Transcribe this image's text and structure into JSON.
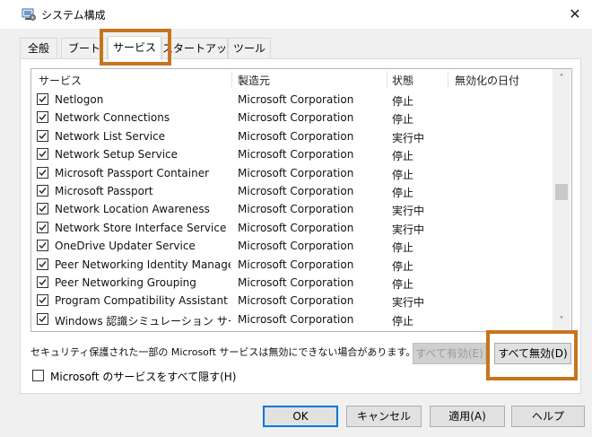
{
  "window": {
    "title": "システム構成",
    "close_glyph": "✕"
  },
  "tabs": [
    {
      "label": "全般"
    },
    {
      "label": "ブート"
    },
    {
      "label": "サービス",
      "active": true
    },
    {
      "label": "スタートアップ"
    },
    {
      "label": "ツール"
    }
  ],
  "services": {
    "columns": [
      "サービス",
      "製造元",
      "状態",
      "無効化の日付"
    ],
    "rows": [
      {
        "name": "Netlogon",
        "maker": "Microsoft Corporation",
        "status": "停止",
        "checked": true
      },
      {
        "name": "Network Connections",
        "maker": "Microsoft Corporation",
        "status": "停止",
        "checked": true
      },
      {
        "name": "Network List Service",
        "maker": "Microsoft Corporation",
        "status": "実行中",
        "checked": true
      },
      {
        "name": "Network Setup Service",
        "maker": "Microsoft Corporation",
        "status": "停止",
        "checked": true
      },
      {
        "name": "Microsoft Passport Container",
        "maker": "Microsoft Corporation",
        "status": "停止",
        "checked": true
      },
      {
        "name": "Microsoft Passport",
        "maker": "Microsoft Corporation",
        "status": "停止",
        "checked": true
      },
      {
        "name": "Network Location Awareness",
        "maker": "Microsoft Corporation",
        "status": "実行中",
        "checked": true
      },
      {
        "name": "Network Store Interface Service",
        "maker": "Microsoft Corporation",
        "status": "実行中",
        "checked": true
      },
      {
        "name": "OneDrive Updater Service",
        "maker": "Microsoft Corporation",
        "status": "停止",
        "checked": true
      },
      {
        "name": "Peer Networking Identity Manager",
        "maker": "Microsoft Corporation",
        "status": "停止",
        "checked": true
      },
      {
        "name": "Peer Networking Grouping",
        "maker": "Microsoft Corporation",
        "status": "停止",
        "checked": true
      },
      {
        "name": "Program Compatibility Assistant ...",
        "maker": "Microsoft Corporation",
        "status": "実行中",
        "checked": true
      },
      {
        "name": "Windows 認識シミュレーション サービス",
        "maker": "Microsoft Corporation",
        "status": "停止",
        "checked": true
      }
    ],
    "scroll_up_glyph": "˄",
    "scroll_down_glyph": "˅"
  },
  "note": "セキュリティ保護された一部の Microsoft サービスは無効にできない場合があります。",
  "enable_all_label": "すべて有効(E)",
  "disable_all_label": "すべて無効(D)",
  "hide_ms_label": "Microsoft のサービスをすべて隠す(H)",
  "footer": {
    "ok": "OK",
    "cancel": "キャンセル",
    "apply": "適用(A)",
    "help": "ヘルプ"
  },
  "colors": {
    "highlight": "#c8741e",
    "primary_border": "#0078d7"
  },
  "icons": {
    "app": "system-config-icon",
    "check": "checkmark-icon"
  }
}
